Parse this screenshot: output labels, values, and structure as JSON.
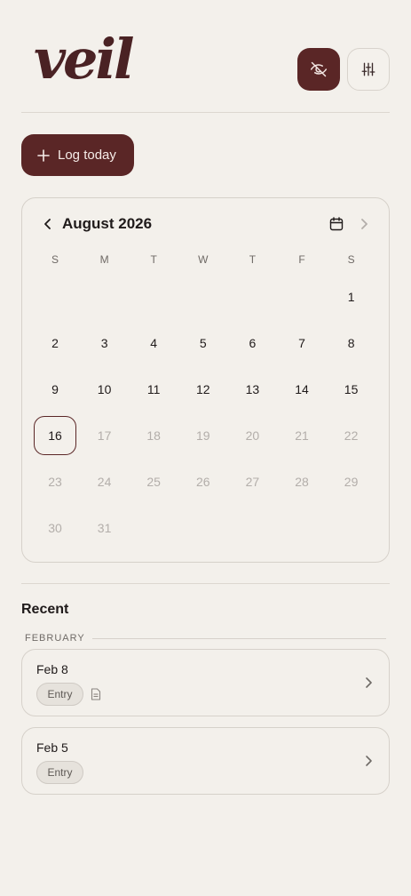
{
  "app": {
    "logo": "veil"
  },
  "header": {
    "privacy_icon": "eye-off-icon",
    "settings_icon": "sliders-icon"
  },
  "actions": {
    "log_today_label": "Log today",
    "log_today_icon": "plus-icon"
  },
  "calendar": {
    "month_label": "August 2026",
    "weekdays": [
      "S",
      "M",
      "T",
      "W",
      "T",
      "F",
      "S"
    ],
    "weeks": [
      [
        null,
        null,
        null,
        null,
        null,
        null,
        {
          "n": "1",
          "muted": false
        }
      ],
      [
        {
          "n": "2",
          "muted": false
        },
        {
          "n": "3",
          "muted": false
        },
        {
          "n": "4",
          "muted": false
        },
        {
          "n": "5",
          "muted": false
        },
        {
          "n": "6",
          "muted": false
        },
        {
          "n": "7",
          "muted": false
        },
        {
          "n": "8",
          "muted": false
        }
      ],
      [
        {
          "n": "9",
          "muted": false
        },
        {
          "n": "10",
          "muted": false
        },
        {
          "n": "11",
          "muted": false
        },
        {
          "n": "12",
          "muted": false
        },
        {
          "n": "13",
          "muted": false
        },
        {
          "n": "14",
          "muted": false
        },
        {
          "n": "15",
          "muted": false
        }
      ],
      [
        {
          "n": "16",
          "muted": false,
          "today": true
        },
        {
          "n": "17",
          "muted": true
        },
        {
          "n": "18",
          "muted": true
        },
        {
          "n": "19",
          "muted": true
        },
        {
          "n": "20",
          "muted": true
        },
        {
          "n": "21",
          "muted": true
        },
        {
          "n": "22",
          "muted": true
        }
      ],
      [
        {
          "n": "23",
          "muted": true
        },
        {
          "n": "24",
          "muted": true
        },
        {
          "n": "25",
          "muted": true
        },
        {
          "n": "26",
          "muted": true
        },
        {
          "n": "27",
          "muted": true
        },
        {
          "n": "28",
          "muted": true
        },
        {
          "n": "29",
          "muted": true
        }
      ],
      [
        {
          "n": "30",
          "muted": true
        },
        {
          "n": "31",
          "muted": true
        },
        null,
        null,
        null,
        null,
        null
      ]
    ]
  },
  "recent": {
    "title": "Recent",
    "groups": [
      {
        "month": "FEBRUARY",
        "entries": [
          {
            "date": "Feb 8",
            "badge": "Entry",
            "has_note": true
          },
          {
            "date": "Feb 5",
            "badge": "Entry",
            "has_note": false
          }
        ]
      }
    ]
  },
  "colors": {
    "accent": "#5a2626",
    "background": "#f3f0eb",
    "muted_text": "#b3aeaa"
  }
}
